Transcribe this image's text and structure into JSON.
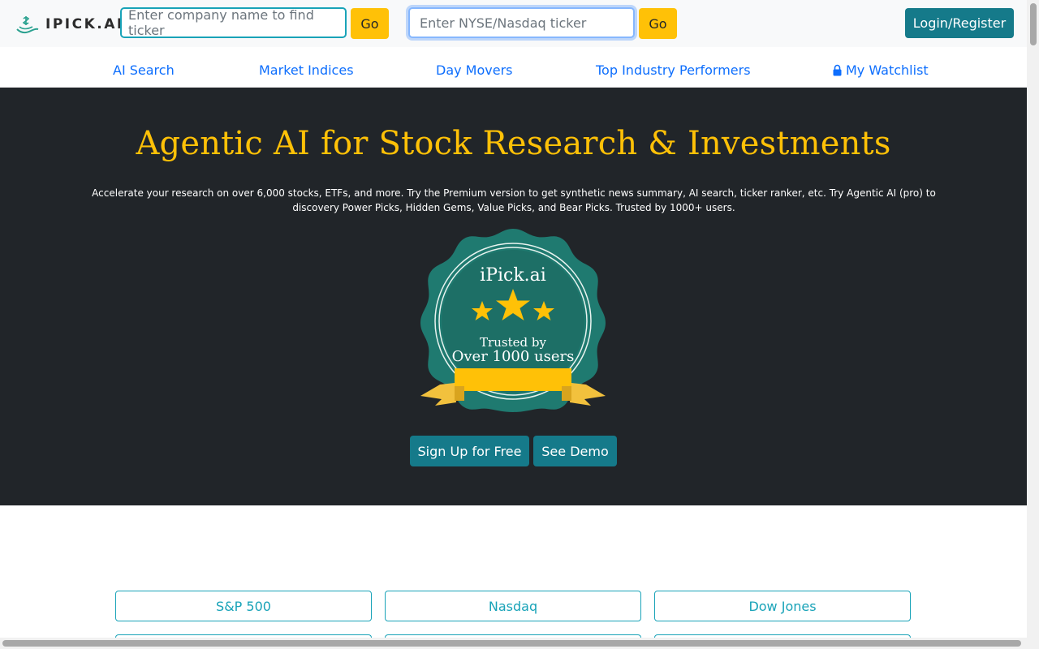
{
  "brand": {
    "logo_text": "IPICK.AI"
  },
  "search": {
    "company_placeholder": "Enter company name to find ticker",
    "company_go": "Go",
    "ticker_placeholder": "Enter NYSE/Nasdaq ticker",
    "ticker_go": "Go"
  },
  "header": {
    "login_label": "Login/Register"
  },
  "nav": {
    "items": [
      {
        "label": "AI Search"
      },
      {
        "label": "Market Indices"
      },
      {
        "label": "Day Movers"
      },
      {
        "label": "Top Industry Performers"
      },
      {
        "label": "My Watchlist",
        "icon": "lock-icon"
      }
    ]
  },
  "hero": {
    "title": "Agentic AI for Stock Research & Investments",
    "subtitle": "Accelerate your research on over 6,000 stocks, ETFs, and more. Try the Premium version to get synthetic news summary, AI search, ticker ranker, etc. Try Agentic AI (pro) to discovery Power Picks, Hidden Gems, Value Picks, and Bear Picks. Trusted by 1000+ users.",
    "badge": {
      "brand": "iPick.ai",
      "line1": "Trusted by",
      "line2": "Over 1000 users",
      "stars": 3
    },
    "signup_label": "Sign Up for Free",
    "demo_label": "See Demo"
  },
  "indices": {
    "items": [
      {
        "label": "S&P 500"
      },
      {
        "label": "Nasdaq"
      },
      {
        "label": "Dow Jones"
      }
    ]
  },
  "colors": {
    "accent_yellow": "#ffc107",
    "teal": "#157a8a",
    "link_blue": "#0d6efd",
    "hero_bg": "#212529",
    "outline_teal": "#19a3b8"
  }
}
